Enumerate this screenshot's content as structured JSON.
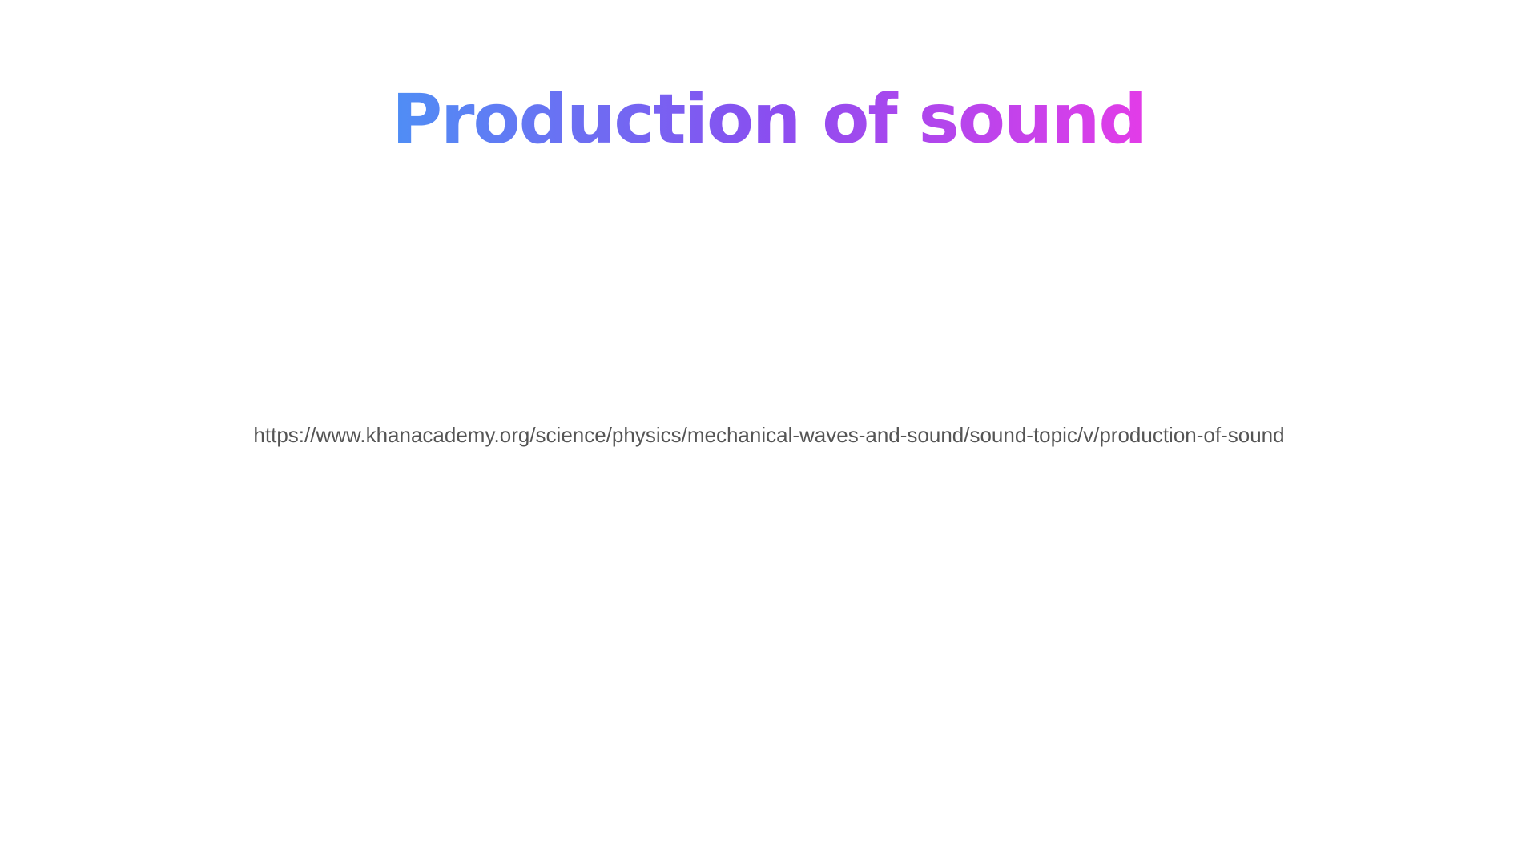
{
  "slide": {
    "title": "Production of sound",
    "link_text": "https://www.khanacademy.org/science/physics/mechanical-waves-and-sound/sound-topic/v/production-of-sound"
  },
  "colors": {
    "background": "#ffffff",
    "title_gradient_start": "#4f8ef5",
    "title_gradient_mid": "#8a4ef0",
    "title_gradient_end": "#e33ce8",
    "link_text": "#555555"
  }
}
